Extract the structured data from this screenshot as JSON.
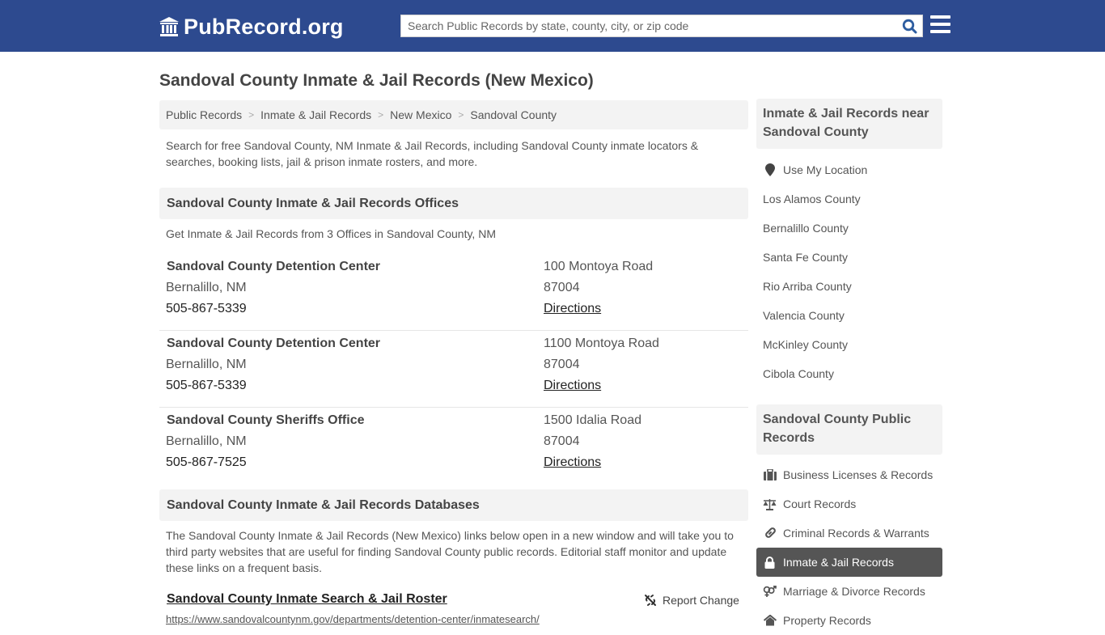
{
  "header": {
    "logo_text": "PubRecord.org",
    "search_placeholder": "Search Public Records by state, county, city, or zip code"
  },
  "page_title": "Sandoval County Inmate & Jail Records (New Mexico)",
  "breadcrumb": [
    "Public Records",
    "Inmate & Jail Records",
    "New Mexico",
    "Sandoval County"
  ],
  "intro": "Search for free Sandoval County, NM Inmate & Jail Records, including Sandoval County inmate locators & searches, booking lists, jail & prison inmate rosters, and more.",
  "offices_section": {
    "title": "Sandoval County Inmate & Jail Records Offices",
    "subtitle": "Get Inmate & Jail Records from 3 Offices in Sandoval County, NM",
    "offices": [
      {
        "name": "Sandoval County Detention Center",
        "city": "Bernalillo, NM",
        "phone": "505-867-5339",
        "address": "100 Montoya Road",
        "zip": "87004",
        "directions": "Directions"
      },
      {
        "name": "Sandoval County Detention Center",
        "city": "Bernalillo, NM",
        "phone": "505-867-5339",
        "address": "1100 Montoya Road",
        "zip": "87004",
        "directions": "Directions"
      },
      {
        "name": "Sandoval County Sheriffs Office",
        "city": "Bernalillo, NM",
        "phone": "505-867-7525",
        "address": "1500 Idalia Road",
        "zip": "87004",
        "directions": "Directions"
      }
    ]
  },
  "databases_section": {
    "title": "Sandoval County Inmate & Jail Records Databases",
    "intro": "The Sandoval County Inmate & Jail Records (New Mexico) links below open in a new window and will take you to third party websites that are useful for finding Sandoval County public records. Editorial staff monitor and update these links on a frequent basis.",
    "links": [
      {
        "title": "Sandoval County Inmate Search & Jail Roster",
        "url": "https://www.sandovalcountynm.gov/departments/detention-center/inmatesearch/",
        "report_label": "Report Change"
      }
    ]
  },
  "sidebar": {
    "nearby_title": "Inmate & Jail Records near Sandoval County",
    "use_location": "Use My Location",
    "nearby": [
      "Los Alamos County",
      "Bernalillo County",
      "Santa Fe County",
      "Rio Arriba County",
      "Valencia County",
      "McKinley County",
      "Cibola County"
    ],
    "public_title": "Sandoval County Public Records",
    "public_records": [
      {
        "label": "Business Licenses & Records",
        "icon": "briefcase-icon"
      },
      {
        "label": "Court Records",
        "icon": "scales-icon"
      },
      {
        "label": "Criminal Records & Warrants",
        "icon": "link-icon"
      },
      {
        "label": "Inmate & Jail Records",
        "icon": "lock-icon",
        "active": true
      },
      {
        "label": "Marriage & Divorce Records",
        "icon": "gender-icon"
      },
      {
        "label": "Property Records",
        "icon": "home-icon"
      }
    ]
  },
  "colors": {
    "header_bg": "#2d4a8f",
    "search_icon": "#2d5da0",
    "active_item_bg": "#555555",
    "panel_bg": "#f3f3f3"
  }
}
